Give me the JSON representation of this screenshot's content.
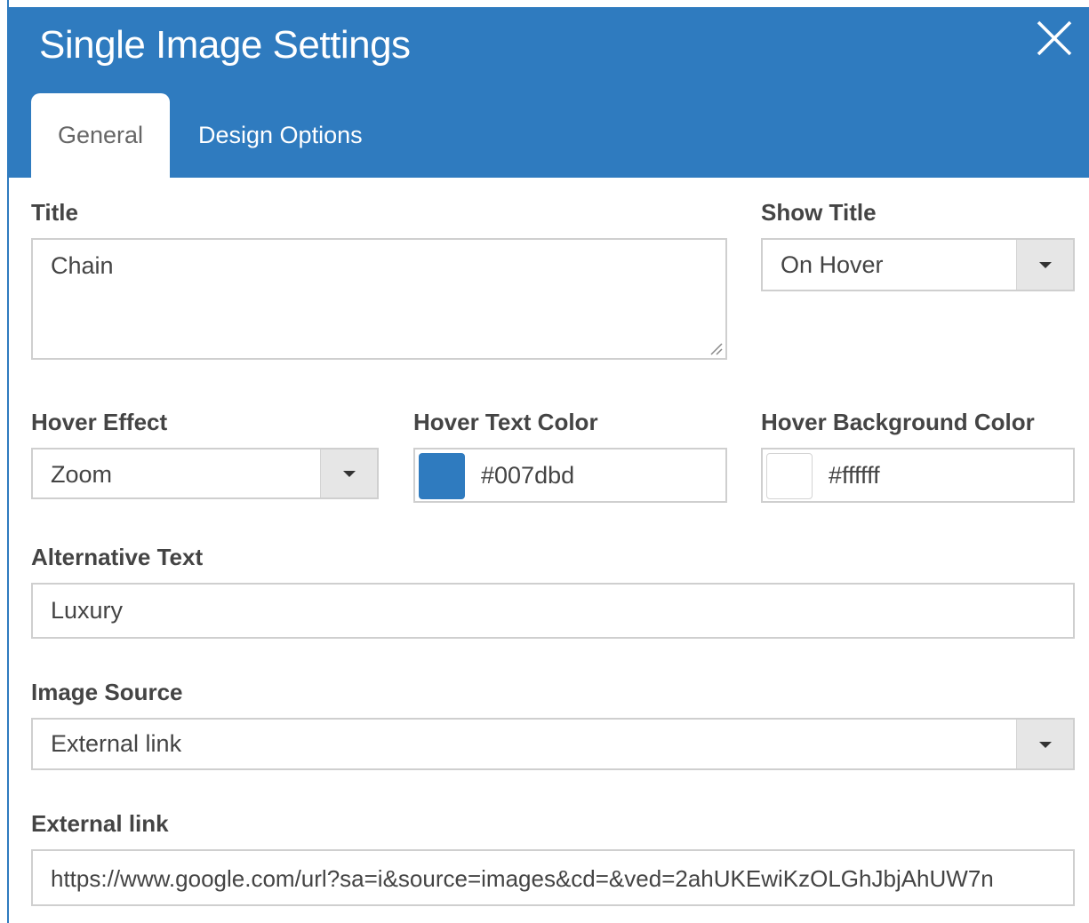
{
  "window": {
    "title": "Single Image Settings",
    "close_icon": "close-icon"
  },
  "tabs": [
    {
      "label": "General",
      "active": true
    },
    {
      "label": "Design Options",
      "active": false
    }
  ],
  "fields": {
    "title": {
      "label": "Title",
      "value": "Chain"
    },
    "show_title": {
      "label": "Show Title",
      "value": "On Hover"
    },
    "hover_effect": {
      "label": "Hover Effect",
      "value": "Zoom"
    },
    "hover_text_color": {
      "label": "Hover Text Color",
      "value": "#007dbd",
      "swatch": "#2f7bbf"
    },
    "hover_bg_color": {
      "label": "Hover Background Color",
      "value": "#ffffff",
      "swatch": "#ffffff"
    },
    "alt_text": {
      "label": "Alternative Text",
      "value": "Luxury"
    },
    "image_source": {
      "label": "Image Source",
      "value": "External link"
    },
    "external_link": {
      "label": "External link",
      "value": "https://www.google.com/url?sa=i&source=images&cd=&ved=2ahUKEwiKzOLGhJbjAhUW7n"
    }
  },
  "colors": {
    "header": "#2f7bbf",
    "accent": "#2f7bbf"
  }
}
